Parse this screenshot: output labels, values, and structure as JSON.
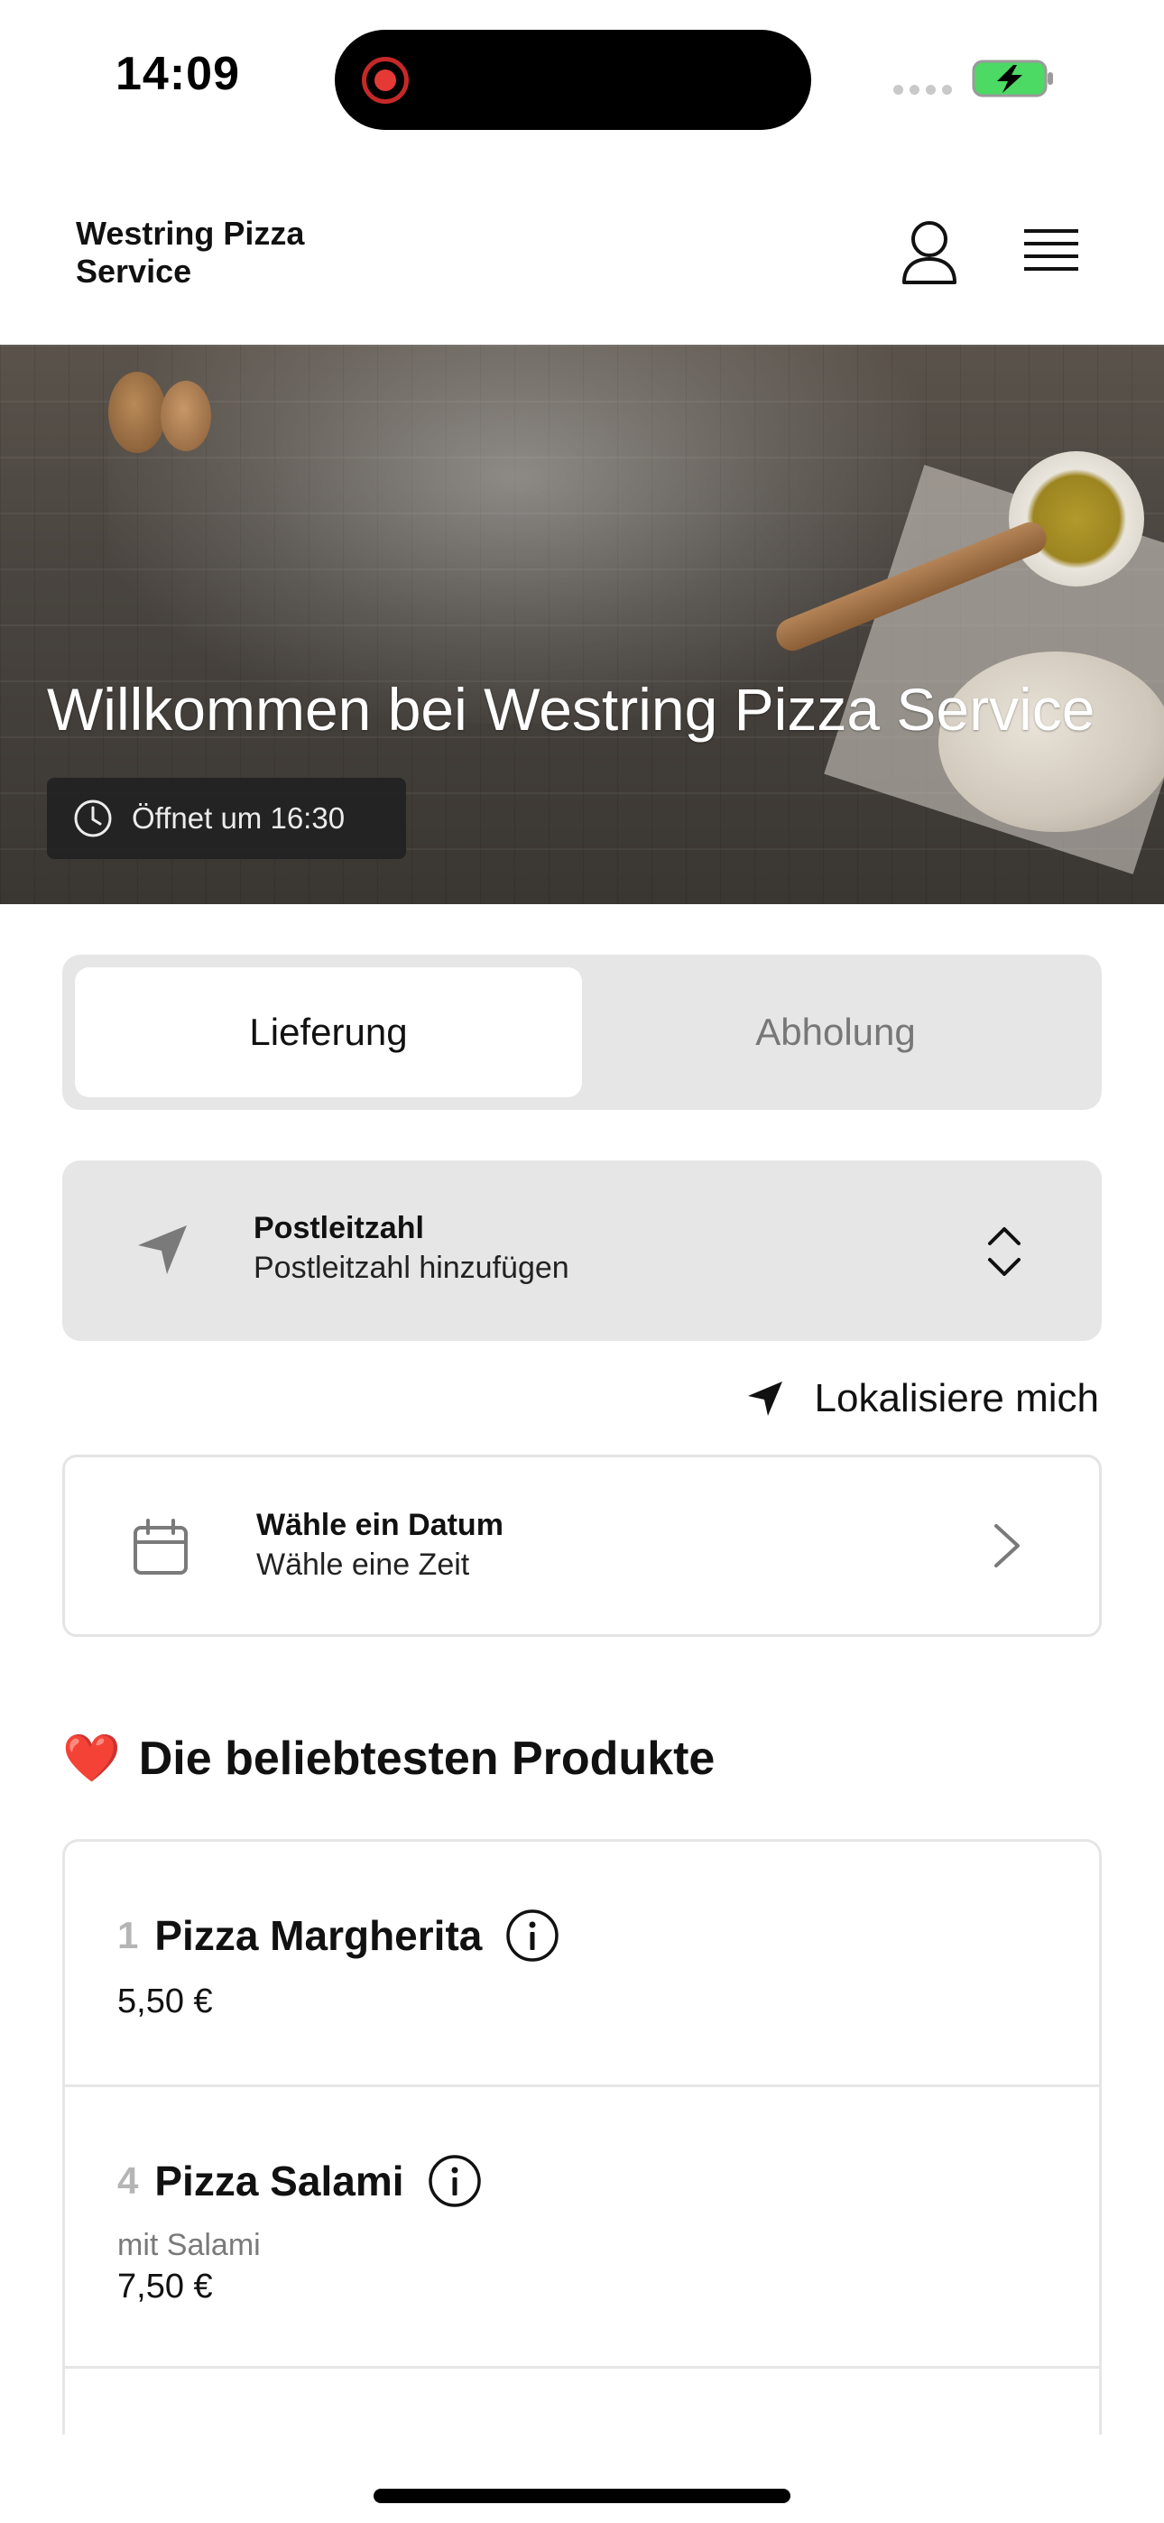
{
  "status_bar": {
    "time": "14:09"
  },
  "header": {
    "brand": "Westring Pizza Service",
    "icons": [
      "user-icon",
      "menu-icon"
    ]
  },
  "hero": {
    "title": "Willkommen bei Westring Pizza Service",
    "opening": "Öffnet um 16:30"
  },
  "order_mode": {
    "delivery_label": "Lieferung",
    "pickup_label": "Abholung",
    "selected": "Lieferung"
  },
  "postal": {
    "title": "Postleitzahl",
    "placeholder": "Postleitzahl hinzufügen"
  },
  "locate": {
    "label": "Lokalisiere mich"
  },
  "date": {
    "title": "Wähle ein Datum",
    "subtitle": "Wähle eine Zeit"
  },
  "popular": {
    "emoji": "❤️",
    "title": "Die beliebtesten Produkte",
    "items": [
      {
        "number": "1",
        "name": "Pizza Margherita",
        "description": "",
        "price": "5,50 €"
      },
      {
        "number": "4",
        "name": "Pizza Salami",
        "description": "mit Salami",
        "price": "7,50 €"
      }
    ]
  },
  "colors": {
    "segment_bg": "#e6e6e6",
    "inactive_text": "#777777",
    "hero_overlay": "#3a3632"
  }
}
